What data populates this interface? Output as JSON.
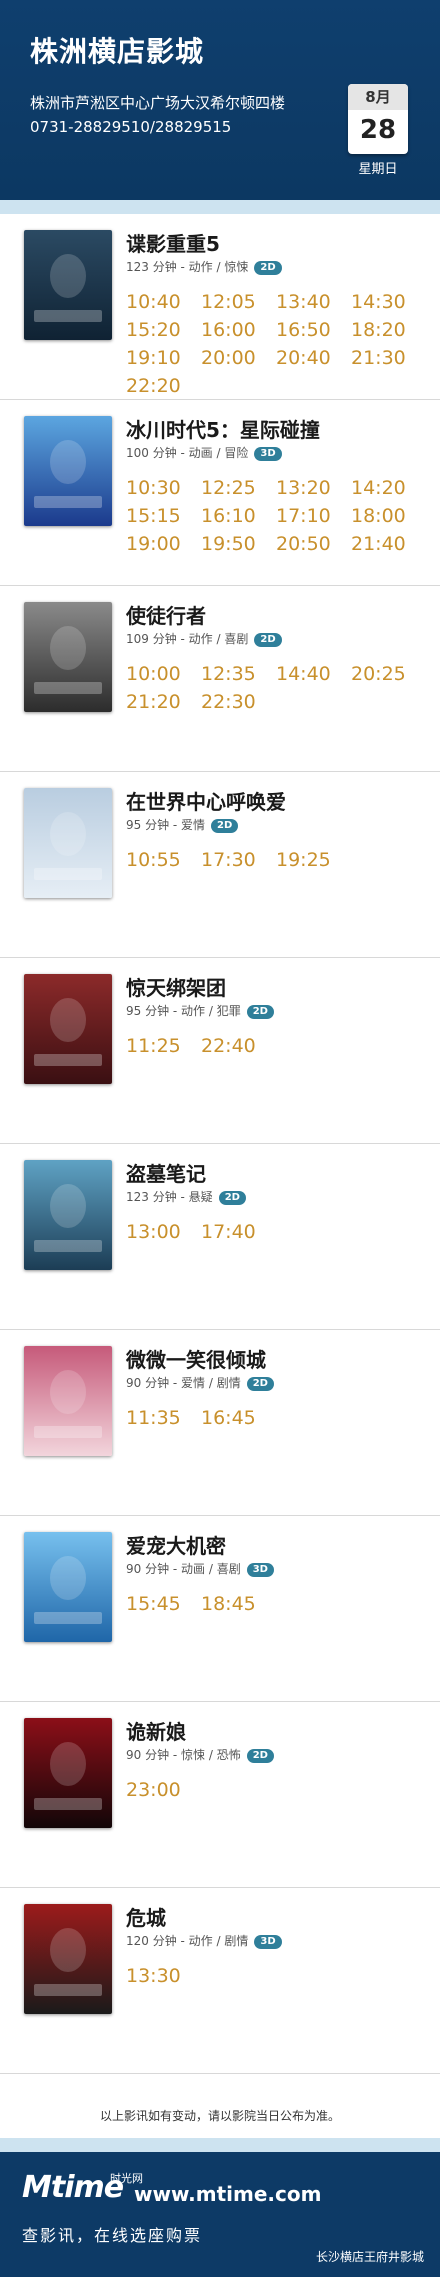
{
  "header": {
    "cinema_name": "株洲横店影城",
    "address": "株洲市芦淞区中心广场大汉希尔顿四楼",
    "phone": "0731-28829510/28829515",
    "date": {
      "month": "8月",
      "day": "28",
      "weekday": "星期日"
    }
  },
  "movies": [
    {
      "title": "谍影重重5",
      "meta": "123 分钟 - 动作 / 惊悚",
      "format": "2D",
      "times": [
        "10:40",
        "12:05",
        "13:40",
        "14:30",
        "15:20",
        "16:00",
        "16:50",
        "18:20",
        "19:10",
        "20:00",
        "20:40",
        "21:30",
        "22:20"
      ],
      "poster_colors": [
        "#0f2233",
        "#2b4a63"
      ]
    },
    {
      "title": "冰川时代5：星际碰撞",
      "meta": "100 分钟 - 动画 / 冒险",
      "format": "3D",
      "times": [
        "10:30",
        "12:25",
        "13:20",
        "14:20",
        "15:15",
        "16:10",
        "17:10",
        "18:00",
        "19:00",
        "19:50",
        "20:50",
        "21:40"
      ],
      "poster_colors": [
        "#1b3a8c",
        "#5ca6e0"
      ]
    },
    {
      "title": "使徒行者",
      "meta": "109 分钟 - 动作 / 喜剧",
      "format": "2D",
      "times": [
        "10:00",
        "12:35",
        "14:40",
        "20:25",
        "21:20",
        "22:30"
      ],
      "poster_colors": [
        "#2c2c2c",
        "#8a8a8a"
      ]
    },
    {
      "title": "在世界中心呼唤爱",
      "meta": "95 分钟 - 爱情",
      "format": "2D",
      "times": [
        "10:55",
        "17:30",
        "19:25"
      ],
      "poster_colors": [
        "#e6eef5",
        "#b9cde0"
      ]
    },
    {
      "title": "惊天绑架团",
      "meta": "95 分钟 - 动作 / 犯罪",
      "format": "2D",
      "times": [
        "11:25",
        "22:40"
      ],
      "poster_colors": [
        "#3a0f12",
        "#8c2a2a"
      ]
    },
    {
      "title": "盗墓笔记",
      "meta": "123 分钟 - 悬疑",
      "format": "2D",
      "times": [
        "13:00",
        "17:40"
      ],
      "poster_colors": [
        "#1c3d55",
        "#5fa2c4"
      ]
    },
    {
      "title": "微微一笑很倾城",
      "meta": "90 分钟 - 爱情 / 剧情",
      "format": "2D",
      "times": [
        "11:35",
        "16:45"
      ],
      "poster_colors": [
        "#f2d5dc",
        "#c65a7a"
      ]
    },
    {
      "title": "爱宠大机密",
      "meta": "90 分钟 - 动画 / 喜剧",
      "format": "3D",
      "times": [
        "15:45",
        "18:45"
      ],
      "poster_colors": [
        "#1f66a8",
        "#77c0ee"
      ]
    },
    {
      "title": "诡新娘",
      "meta": "90 分钟 - 惊悚 / 恐怖",
      "format": "2D",
      "times": [
        "23:00"
      ],
      "poster_colors": [
        "#120608",
        "#8c0f18"
      ]
    },
    {
      "title": "危城",
      "meta": "120 分钟 - 动作 / 剧情",
      "format": "3D",
      "times": [
        "13:30"
      ],
      "poster_colors": [
        "#1a1a1a",
        "#9c1b1b"
      ]
    }
  ],
  "disclaimer": "以上影讯如有变动，请以影院当日公布为准。",
  "footer": {
    "logo": "Mtime",
    "logo_cn": "时光网",
    "url": "www.mtime.com",
    "slogan": "查影讯，在线选座购票",
    "watermark": "长沙横店王府井影城"
  },
  "colors": {
    "header_bg": "#0f3f6e",
    "time_color": "#c8902c",
    "badge_bg": "#2f7f9a"
  }
}
